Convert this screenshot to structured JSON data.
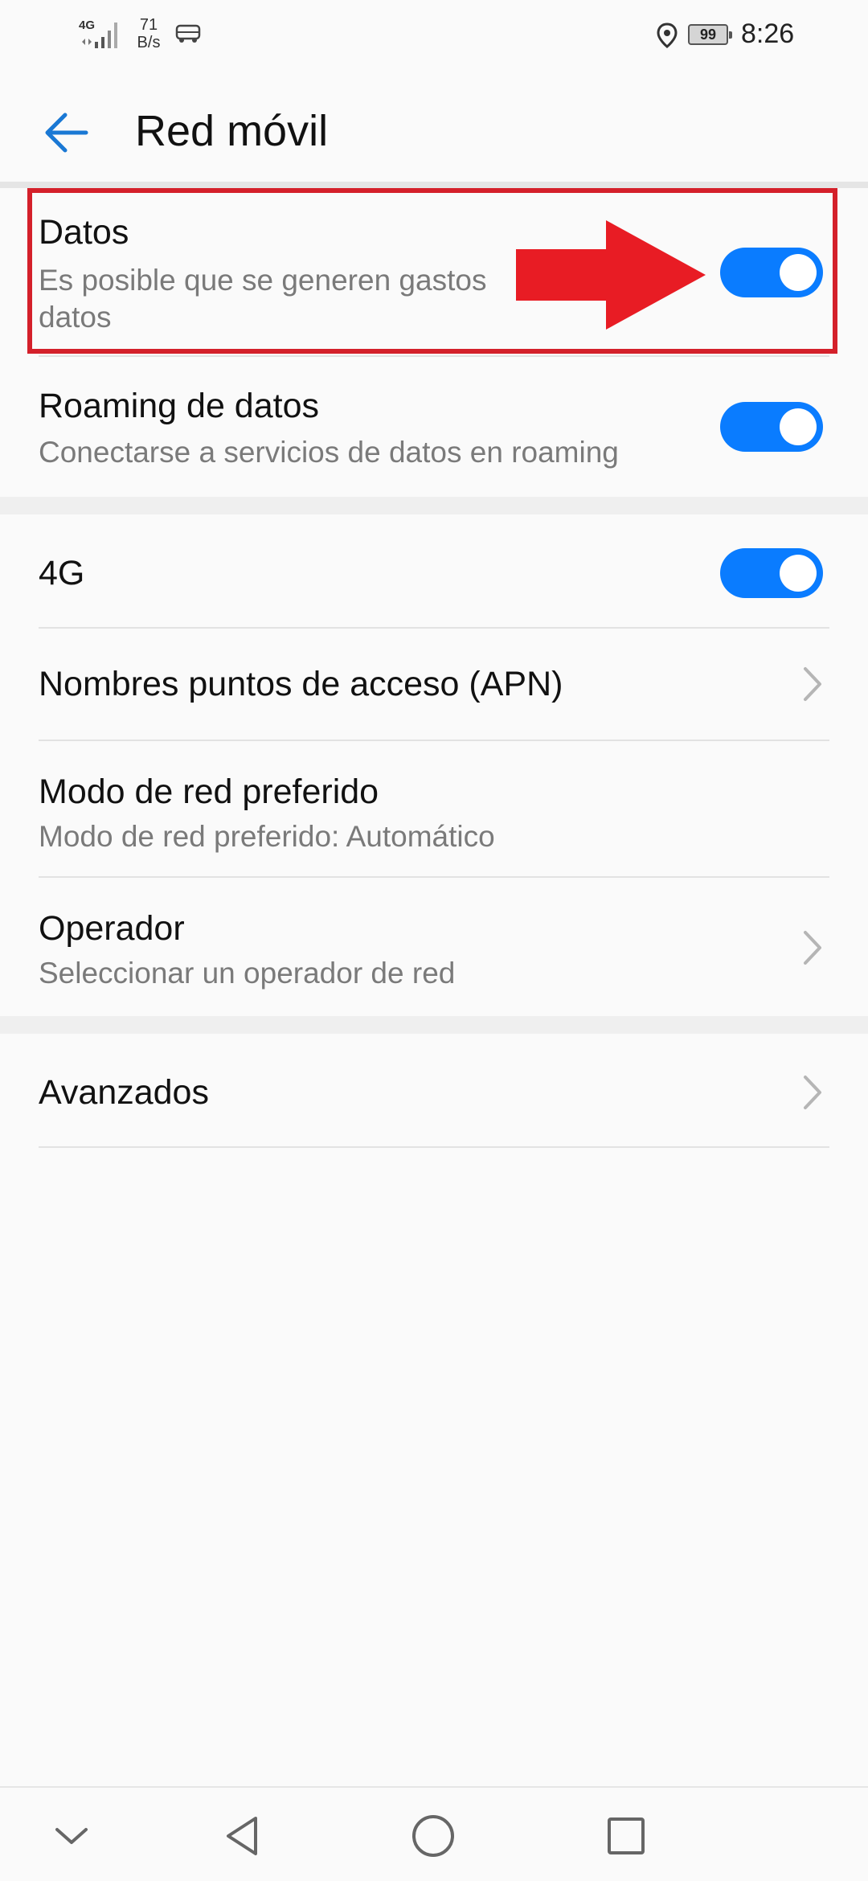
{
  "status_bar": {
    "network_type": "4G",
    "speed_value": "71",
    "speed_unit": "B/s",
    "battery": "99",
    "time": "8:26"
  },
  "header": {
    "title": "Red móvil",
    "back_icon": "arrow-left-icon"
  },
  "settings": {
    "datos": {
      "title": "Datos",
      "subtitle": "Es posible que se generen gastos",
      "subtitle_cont": "datos",
      "enabled": true
    },
    "roaming": {
      "title": "Roaming de datos",
      "subtitle": "Conectarse a servicios de datos en roaming",
      "enabled": true
    },
    "lte": {
      "title": "4G",
      "enabled": true
    },
    "apn": {
      "title": "Nombres puntos de acceso (APN)"
    },
    "network_mode": {
      "title": "Modo de red preferido",
      "subtitle": "Modo de red preferido: Automático"
    },
    "operator": {
      "title": "Operador",
      "subtitle": "Seleccionar un operador de red"
    },
    "advanced": {
      "title": "Avanzados"
    }
  },
  "colors": {
    "accent": "#0a7cff",
    "annotation": "#d4202a"
  },
  "nav_bar": {
    "icons": [
      "chevron-down-icon",
      "back-triangle-icon",
      "home-circle-icon",
      "recents-square-icon"
    ]
  }
}
